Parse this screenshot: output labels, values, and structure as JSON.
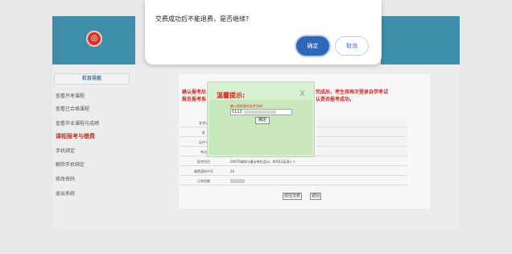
{
  "header": {
    "logo_glyph": "◎"
  },
  "sidebar": {
    "title": "栏目导航",
    "items": [
      {
        "label": "查看开考课程"
      },
      {
        "label": "查看已合格课程"
      },
      {
        "label": "查看毕业课程与成绩"
      },
      {
        "label": "课程报考与缴费",
        "active": true
      },
      {
        "label": "手机绑定"
      },
      {
        "label": "解除手机绑定"
      },
      {
        "label": "修改密码"
      },
      {
        "label": "退出系统"
      }
    ]
  },
  "main": {
    "notice_left_line1": "确认报考后",
    "notice_left_line2": "报名报考系",
    "notice_right_line1": "完成后，考生须再次登录自学考试",
    "notice_right_line2": "认是否报考成功。",
    "rows": [
      {
        "label": "准考证",
        "value": ""
      },
      {
        "label": "姓",
        "value": ""
      },
      {
        "label": "证件号",
        "value": ""
      },
      {
        "label": "考试",
        "value": ""
      },
      {
        "label": "报考科目",
        "value": "00070政府与事业单位会计；00012英语(一)"
      },
      {
        "label": "缴费通知书号",
        "value": "20"
      },
      {
        "label": "订单金额",
        "value": ""
      }
    ],
    "pay_button": "前往交费",
    "back_button": "返回"
  },
  "tip_dialog": {
    "title": "温馨提示:",
    "close": "X",
    "hint": "输入您的身份证件号码",
    "input_value": "5113",
    "confirm": "确定"
  },
  "modal": {
    "message": "交费成功后不能退费，是否继续?",
    "ok": "确定",
    "cancel": "取消"
  },
  "colors": {
    "banner": "#3f8ea9",
    "warning_red": "#d9231c",
    "primary_blue": "#2f68b8",
    "tip_green": "#d7f0cf"
  }
}
